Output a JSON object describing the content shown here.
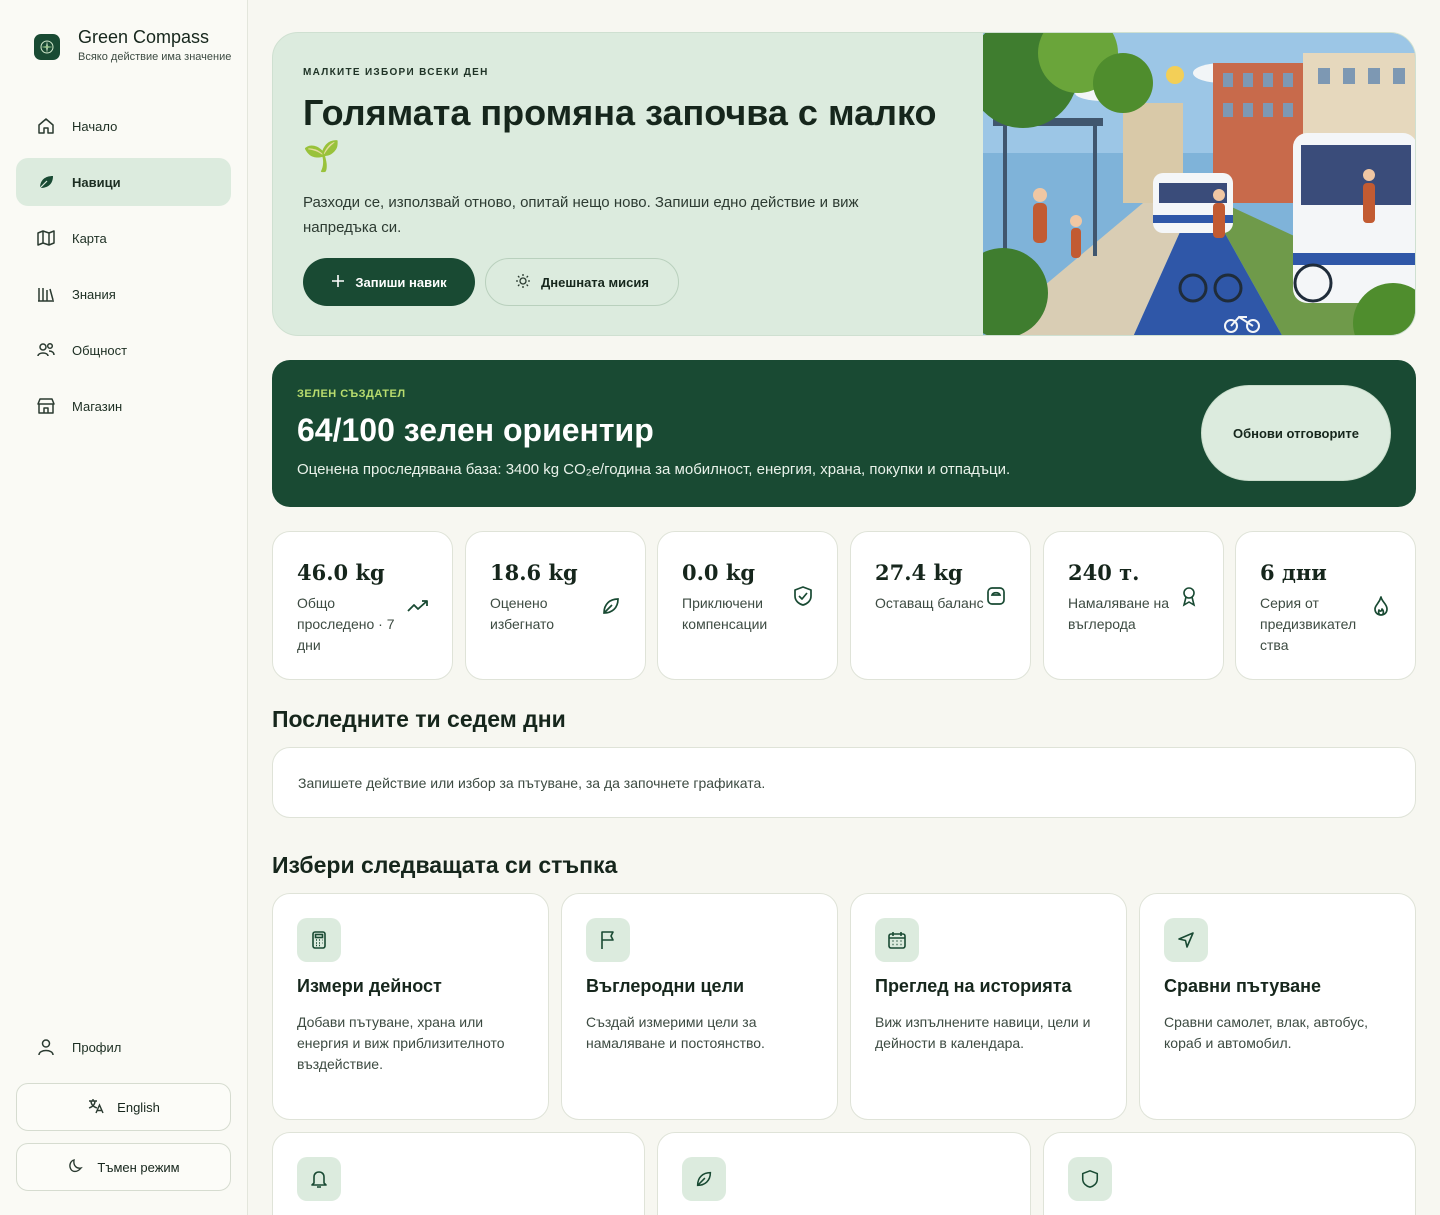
{
  "brand": {
    "title": "Green Compass",
    "subtitle": "Всяко действие има значение"
  },
  "nav": [
    {
      "label": "Начало",
      "icon": "home-icon"
    },
    {
      "label": "Навици",
      "icon": "leaf-icon",
      "active": true
    },
    {
      "label": "Карта",
      "icon": "map-icon"
    },
    {
      "label": "Знания",
      "icon": "library-icon"
    },
    {
      "label": "Общност",
      "icon": "users-icon"
    },
    {
      "label": "Магазин",
      "icon": "store-icon"
    }
  ],
  "sidebar_bottom": {
    "profile": "Профил",
    "language": "English",
    "theme": "Тъмен режим"
  },
  "hero": {
    "eyebrow": "МАЛКИТЕ ИЗБОРИ ВСЕКИ ДЕН",
    "title": "Голямата промяна започва с малко",
    "sprout": "🌱",
    "text": "Разходи се, използвай отново, опитай нещо ново. Запиши едно действие и виж напредъка си.",
    "primary_button": "Запиши навик",
    "secondary_button": "Днешната мисия"
  },
  "score": {
    "eyebrow": "ЗЕЛЕН СЪЗДАТЕЛ",
    "title": "64/100 зелен ориентир",
    "text": "Оценена проследявана база: 3400 kg CO₂e/година за мобилност, енергия, храна, покупки и отпадъци.",
    "button": "Обнови отговорите"
  },
  "stats": [
    {
      "value": "46.0 kg",
      "label": "Общо проследено · 7 дни",
      "icon": "trend-icon"
    },
    {
      "value": "18.6 kg",
      "label": "Оценено избегнато",
      "icon": "leaf-icon"
    },
    {
      "value": "0.0 kg",
      "label": "Приключени компенсации",
      "icon": "shield-check-icon"
    },
    {
      "value": "27.4 kg",
      "label": "Оставащ баланс",
      "icon": "scale-icon"
    },
    {
      "value": "240 т.",
      "label": "Намаляване на въглерода",
      "icon": "award-icon"
    },
    {
      "value": "6 дни",
      "label": "Серия от предизвикател ства",
      "icon": "flame-icon"
    }
  ],
  "week": {
    "title": "Последните ти седем дни",
    "empty": "Запишете действие или избор за пътуване, за да започнете графиката."
  },
  "next": {
    "title": "Избери следващата си стъпка",
    "cards": [
      {
        "title": "Измери дейност",
        "desc": "Добави пътуване, храна или енергия и виж приблизителното въздействие.",
        "icon": "calculator-icon"
      },
      {
        "title": "Въглеродни цели",
        "desc": "Създай измерими цели за намаляване и постоянство.",
        "icon": "flag-icon"
      },
      {
        "title": "Преглед на историята",
        "desc": "Виж изпълнените навици, цели и дейности в календара.",
        "icon": "calendar-icon"
      },
      {
        "title": "Сравни пътуване",
        "desc": "Сравни самолет, влак, автобус, кораб и автомобил.",
        "icon": "navigation-icon"
      }
    ],
    "row2_icons": [
      "bell-icon",
      "leaf-icon",
      "shield-icon"
    ]
  },
  "colors": {
    "accent": "#194a33",
    "mint": "#dcebde",
    "lime": "#b9dc6e",
    "background": "#f7f7f1"
  }
}
